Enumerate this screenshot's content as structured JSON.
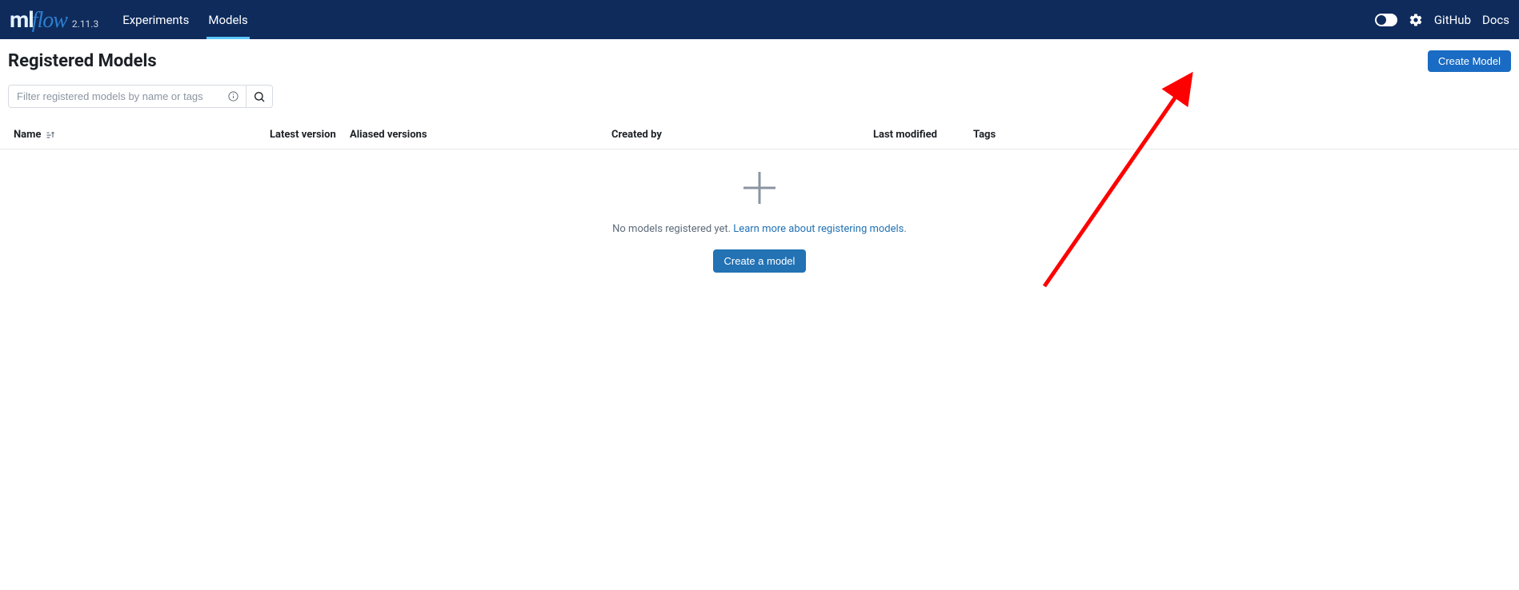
{
  "app": {
    "logo_ml": "ml",
    "logo_flow": "flow",
    "version": "2.11.3"
  },
  "nav": {
    "tabs": [
      {
        "label": "Experiments"
      },
      {
        "label": "Models"
      }
    ],
    "links": {
      "github": "GitHub",
      "docs": "Docs"
    }
  },
  "page": {
    "title": "Registered Models",
    "create_button": "Create Model"
  },
  "filter": {
    "placeholder": "Filter registered models by name or tags"
  },
  "table": {
    "columns": {
      "name": "Name",
      "latest_version": "Latest version",
      "aliased_versions": "Aliased versions",
      "created_by": "Created by",
      "last_modified": "Last modified",
      "tags": "Tags"
    }
  },
  "empty": {
    "message_prefix": "No models registered yet. ",
    "link_text": "Learn more about registering models",
    "message_suffix": ".",
    "create_button": "Create a model"
  }
}
